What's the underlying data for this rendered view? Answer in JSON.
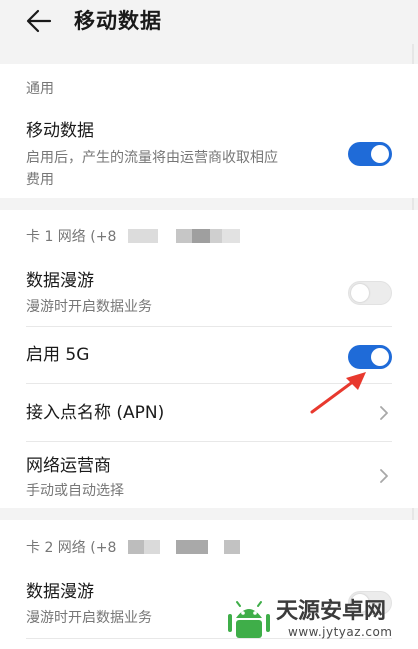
{
  "header": {
    "back_icon": "arrow-left-icon",
    "title": "移动数据"
  },
  "general": {
    "section_label": "通用",
    "mobile_data": {
      "title": "移动数据",
      "summary_line1": "启用后，产生的流量将由运营商收取相应",
      "summary_line2": "费用",
      "enabled": true
    }
  },
  "sim1": {
    "section_label": "卡 1 网络 (+8",
    "roaming": {
      "title": "数据漫游",
      "summary": "漫游时开启数据业务",
      "enabled": false
    },
    "enable_5g": {
      "title": "启用 5G",
      "enabled": true
    },
    "apn": {
      "title": "接入点名称 (APN)",
      "icon": "chevron-right-icon"
    },
    "carrier": {
      "title": "网络运营商",
      "summary": "手动或自动选择",
      "icon": "chevron-right-icon"
    }
  },
  "sim2": {
    "section_label": "卡 2 网络 (+8",
    "roaming": {
      "title": "数据漫游",
      "summary": "漫游时开启数据业务",
      "enabled": false
    }
  },
  "annotation": {
    "arrow_color": "#e8392e"
  },
  "watermark": {
    "text": "天源安卓网",
    "url": "www.jytyaz.com"
  },
  "colors": {
    "accent": "#1f6bd8",
    "background": "#f3f3f3",
    "card": "#ffffff",
    "secondary_text": "#777777"
  }
}
